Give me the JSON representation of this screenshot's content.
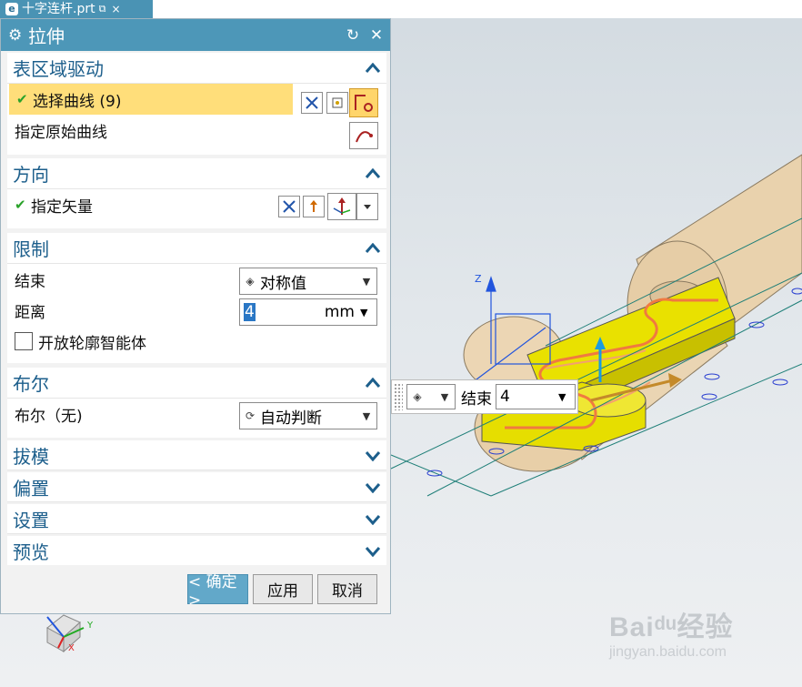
{
  "document_tab": {
    "title": "十字连杆.prt",
    "pin_icon": "pin-icon",
    "close_glyph": "×"
  },
  "dialog": {
    "title": "拉伸",
    "section_region": {
      "title": "表区域驱动",
      "select_curve_label": "选择曲线 (9)",
      "original_curve_label": "指定原始曲线"
    },
    "section_direction": {
      "title": "方向",
      "vector_label": "指定矢量"
    },
    "section_limits": {
      "title": "限制",
      "end_label": "结束",
      "end_value": "对称值",
      "distance_label": "距离",
      "distance_value": "4",
      "distance_unit": "mm",
      "open_profile_label": "开放轮廓智能体"
    },
    "section_boolean": {
      "title": "布尔",
      "boolean_label": "布尔（无)",
      "boolean_value": "自动判断"
    },
    "collapsed_sections": [
      "拔模",
      "偏置",
      "设置",
      "预览"
    ],
    "buttons": {
      "ok": "< 确定 >",
      "apply": "应用",
      "cancel": "取消"
    }
  },
  "float_input": {
    "label": "结束",
    "value": "4"
  },
  "watermark": {
    "logo": "Baiᵈᵘ经验",
    "url": "jingyan.baidu.com"
  },
  "colors": {
    "accent": "#4d97b8",
    "section_title": "#1d5f8c",
    "highlight": "#ffde7a",
    "part_yellow": "#e8e000",
    "part_tan": "#e8cfa6"
  }
}
